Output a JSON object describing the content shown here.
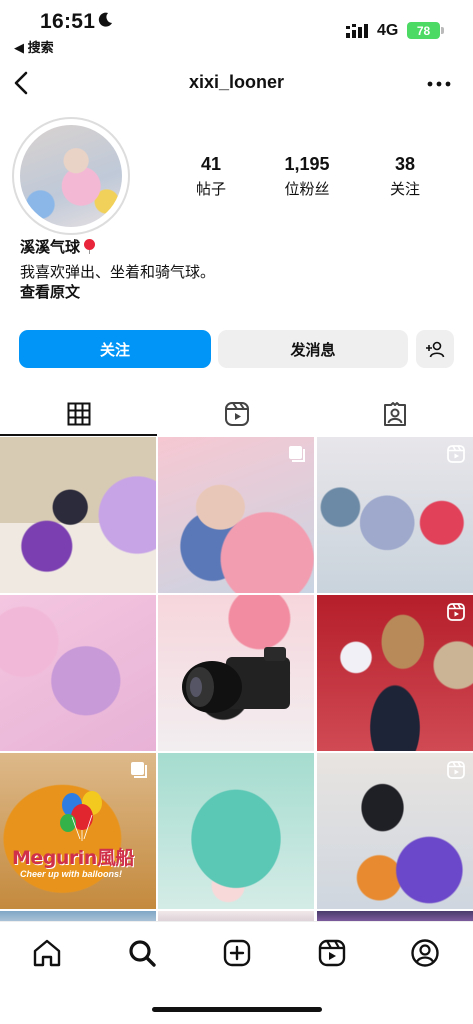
{
  "status_bar": {
    "time": "16:51",
    "back_app_label": "◀ 搜索",
    "network": "4G",
    "battery": "78"
  },
  "header": {
    "username": "xixi_looner"
  },
  "profile": {
    "posts_count": "41",
    "posts_label": "帖子",
    "followers_count": "1,195",
    "followers_label": "位粉丝",
    "following_count": "38",
    "following_label": "关注",
    "display_name": "溪溪气球",
    "bio": "我喜欢弹出、坐着和骑气球。",
    "see_original": "查看原文"
  },
  "actions": {
    "follow_label": "关注",
    "message_label": "发消息"
  },
  "grid": {
    "logo_text": "Megurin風船",
    "logo_subtext": "Cheer up with balloons!"
  },
  "colors": {
    "accent": "#0095f6",
    "battery": "#4cd964"
  }
}
